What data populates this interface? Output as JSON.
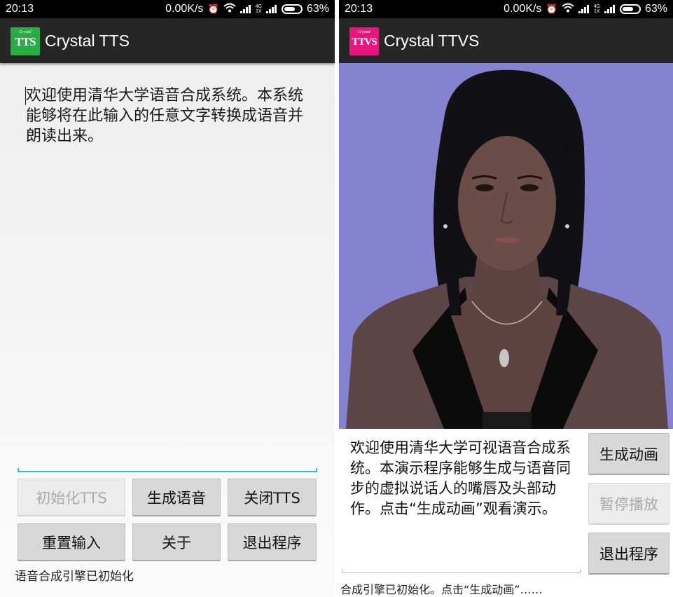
{
  "status_bar": {
    "time": "20:13",
    "net_speed": "0.00K/s",
    "network_label_top": "4G",
    "network_label_bottom": "1X",
    "battery": "63%"
  },
  "left_app": {
    "icon_small_text": "Crystal",
    "icon_big_text": "TTS",
    "icon_color": "#27ae43",
    "title": "Crystal TTS",
    "input_text": "欢迎使用清华大学语音合成系统。本系统能够将在此输入的任意文字转换成语音并朗读出来。",
    "buttons": {
      "init": "初始化TTS",
      "generate": "生成语音",
      "close": "关闭TTS",
      "reset": "重置输入",
      "about": "关于",
      "exit": "退出程序"
    },
    "status": "语音合成引擎已初始化"
  },
  "right_app": {
    "icon_small_text": "Crystal",
    "icon_big_text": "TTVS",
    "icon_color": "#e8157f",
    "title": "Crystal TTVS",
    "avatar_background": "#8582cf",
    "input_text": "欢迎使用清华大学可视语音合成系统。本演示程序能够生成与语音同步的虚拟说话人的嘴唇及头部动作。点击“生成动画”观看演示。",
    "buttons": {
      "animate": "生成动画",
      "pause": "暂停播放",
      "exit": "退出程序"
    },
    "status": "合成引擎已初始化。点击“生成动画”……"
  }
}
